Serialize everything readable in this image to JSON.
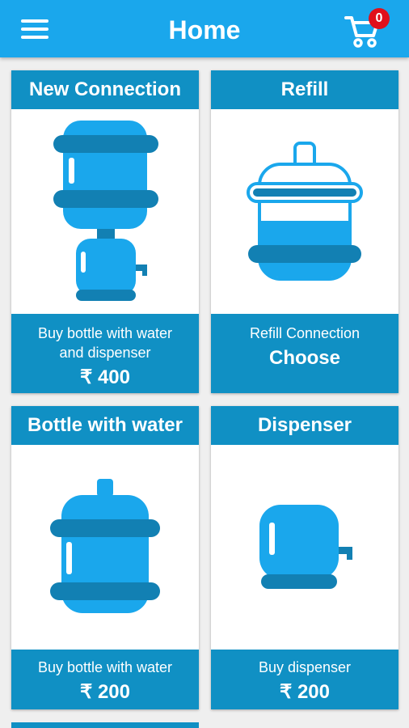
{
  "header": {
    "title": "Home",
    "menu_icon": "hamburger-menu-icon",
    "cart_icon": "shopping-cart-icon",
    "cart_count": "0"
  },
  "cards": [
    {
      "title": "New Connection",
      "description": "Buy bottle with water\nand dispenser",
      "price": "₹ 400",
      "image": "bottle-on-dispenser"
    },
    {
      "title": "Refill",
      "description": "Refill Connection",
      "price": "Choose",
      "image": "refill-bottle"
    },
    {
      "title": "Bottle with water",
      "description": "Buy bottle with water",
      "price": "₹ 200",
      "image": "water-bottle"
    },
    {
      "title": "Dispenser",
      "description": "Buy dispenser",
      "price": "₹ 200",
      "image": "dispenser"
    }
  ],
  "colors": {
    "appbar": "#1aa7ec",
    "card_header": "#1090c4",
    "icon_light": "#1aa7ec",
    "icon_dark": "#1280b3",
    "badge": "#e0101b"
  }
}
